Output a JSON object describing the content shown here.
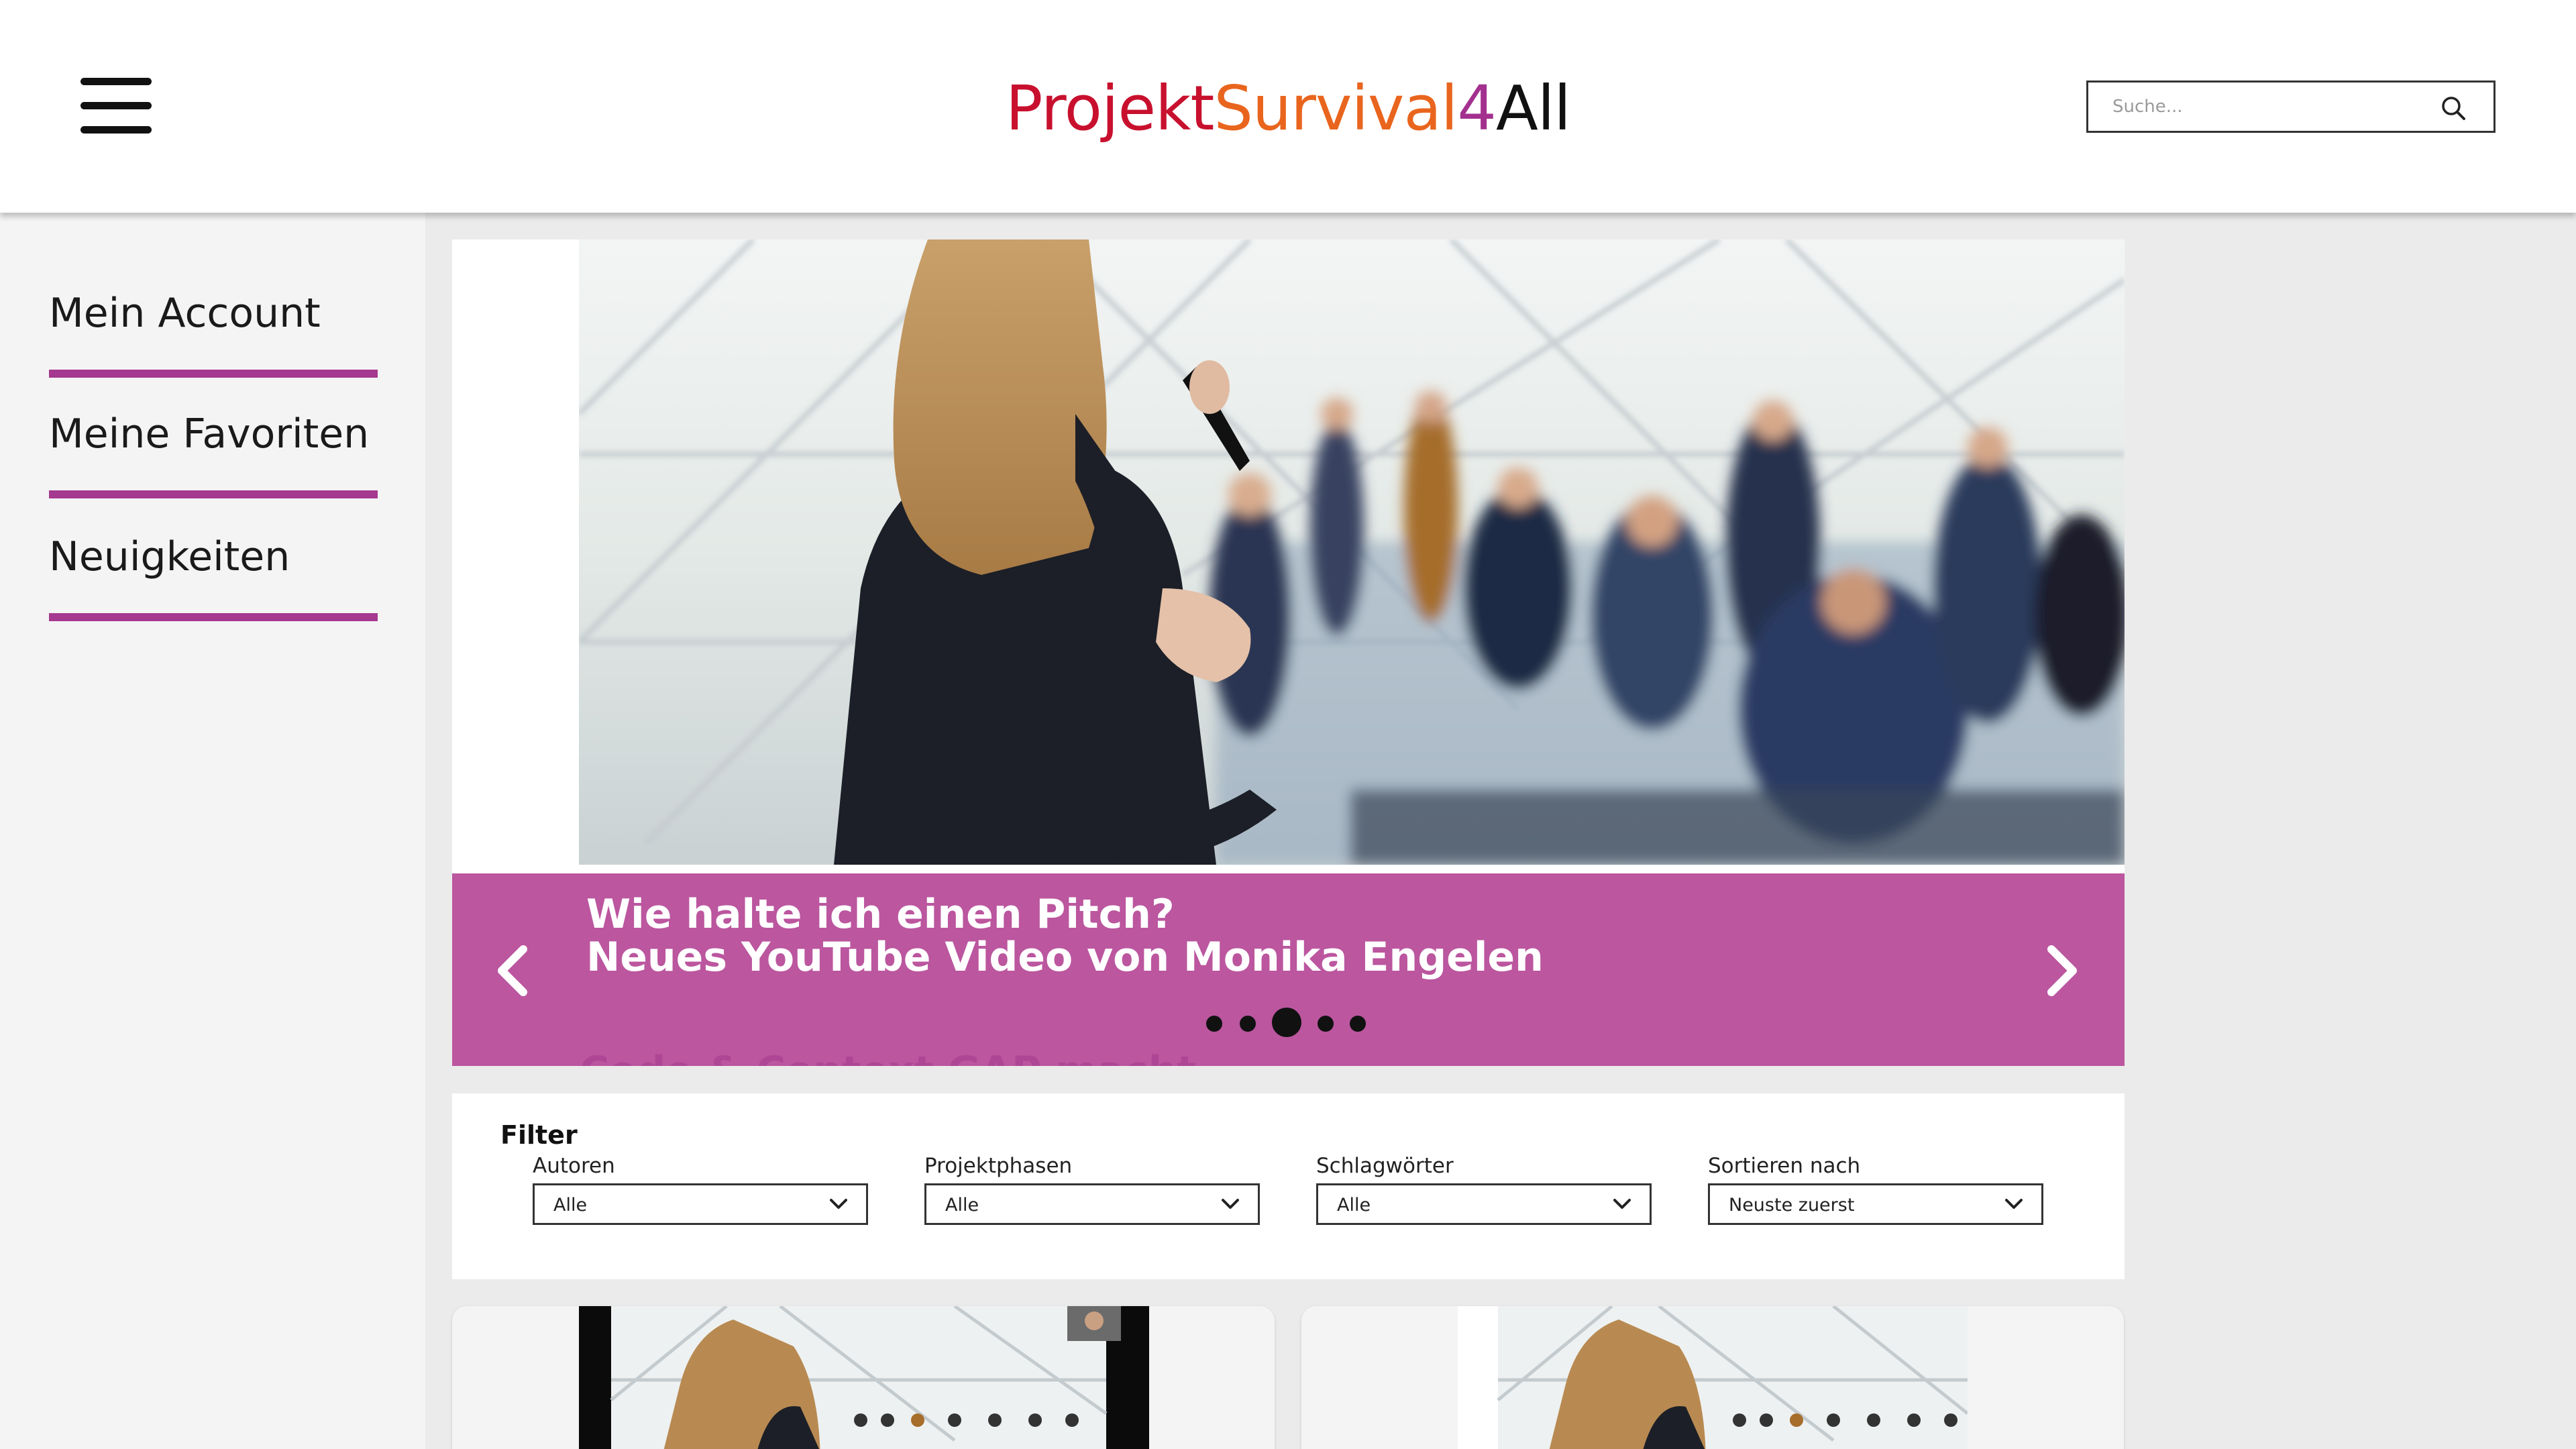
{
  "header": {
    "menu_icon": "hamburger-menu-icon",
    "logo": {
      "part1": "Projekt",
      "part2": "Survival",
      "part3": "4",
      "part4": "All"
    },
    "search": {
      "placeholder": "Suche...",
      "icon": "search-icon"
    }
  },
  "colors": {
    "accent": "#a5388f",
    "caption_bg": "#bb569f",
    "logo_red": "#c8102e",
    "logo_orange": "#e9651e",
    "logo_purple": "#a3308e"
  },
  "sidebar": {
    "items": [
      {
        "label": "Mein Account"
      },
      {
        "label": "Meine Favoriten"
      },
      {
        "label": "Neuigkeiten"
      }
    ]
  },
  "carousel": {
    "title_line1": "Wie halte ich einen Pitch?",
    "title_line2": "Neues YouTube Video von Monika Engelen",
    "next_slide_text": "Code & Context GAP macht Kickflirt",
    "prev_icon": "chevron-left-icon",
    "next_icon": "chevron-right-icon",
    "slide_count": 5,
    "active_slide": 3
  },
  "filter": {
    "title": "Filter",
    "groups": [
      {
        "label": "Autoren",
        "value": "Alle"
      },
      {
        "label": "Projektphasen",
        "value": "Alle"
      },
      {
        "label": "Schlagwörter",
        "value": "Alle"
      },
      {
        "label": "Sortieren nach",
        "value": "Neuste zuerst"
      }
    ]
  }
}
